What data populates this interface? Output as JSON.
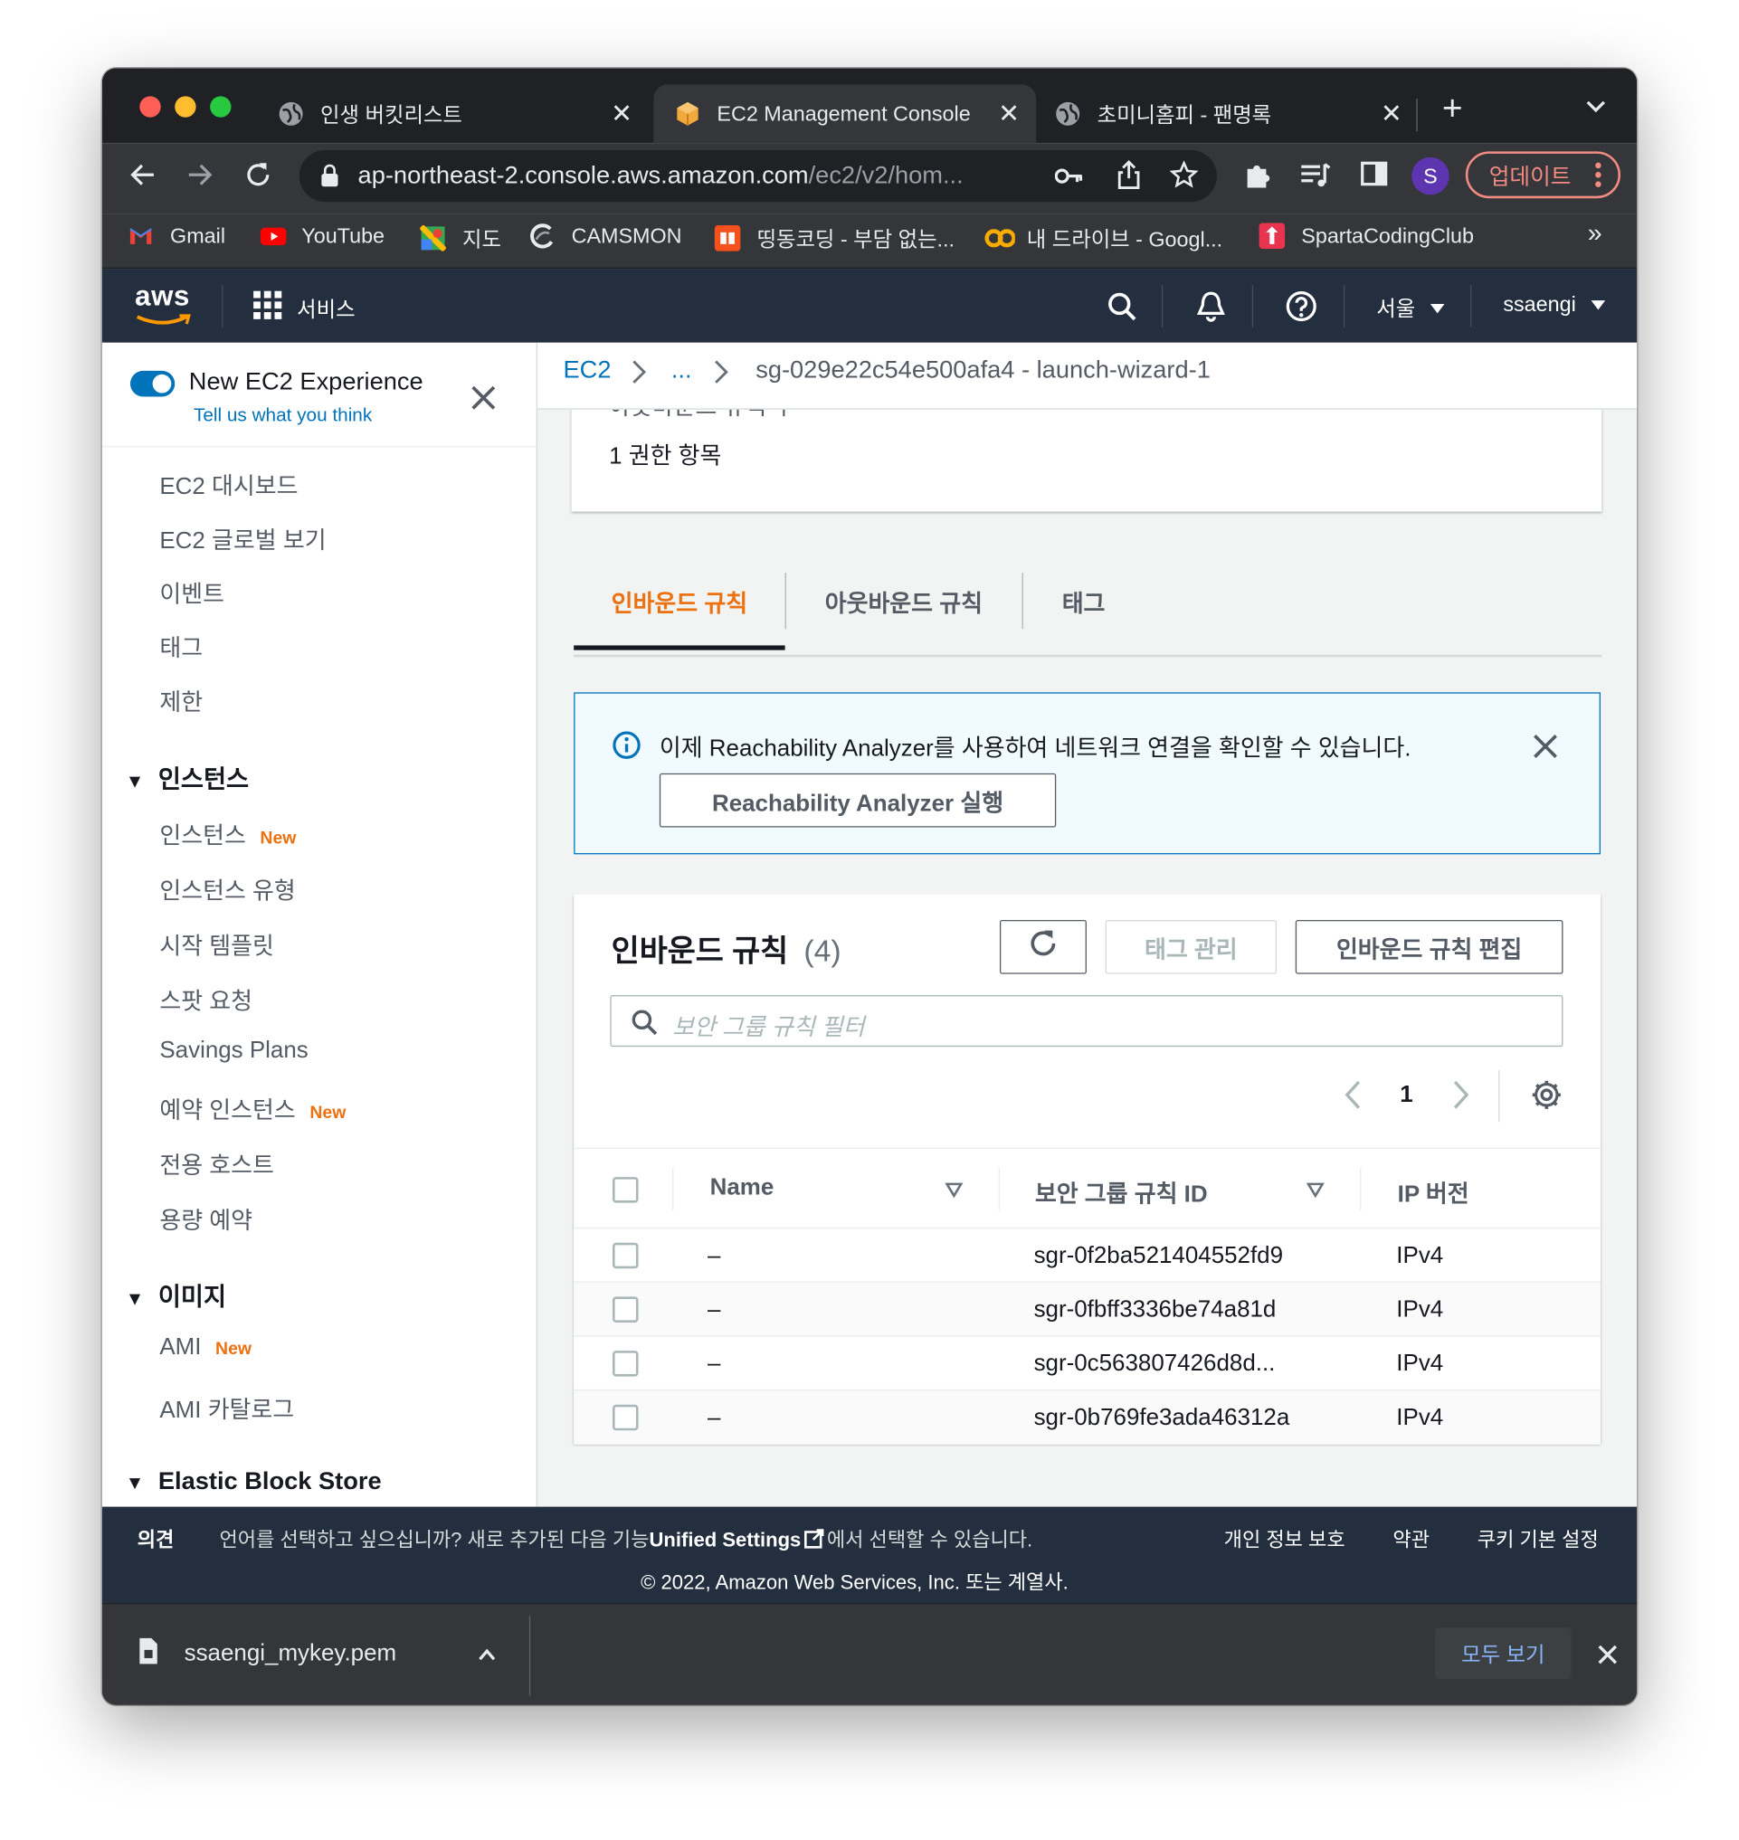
{
  "browser": {
    "tabs": [
      {
        "title": "인생 버킷리스트",
        "active": false
      },
      {
        "title": "EC2 Management Console",
        "active": true
      },
      {
        "title": "초미니홈피 - 팬명록",
        "active": false
      }
    ],
    "url_host": "ap-northeast-2.console.aws.amazon.com",
    "url_path": "/ec2/v2/hom...",
    "profile_initial": "S",
    "update_label": "업데이트",
    "bookmarks": [
      "Gmail",
      "YouTube",
      "지도",
      "CAMSMON",
      "띵동코딩 - 부담 없는...",
      "내 드라이브 - Googl...",
      "SpartaCodingClub"
    ],
    "bookmarks_more": "»"
  },
  "aws": {
    "logo": "aws",
    "services_label": "서비스",
    "region": "서울",
    "user": "ssaengi"
  },
  "sidebar": {
    "new_experience": "New EC2 Experience",
    "feedback_link": "Tell us what you think",
    "top_items": [
      "EC2 대시보드",
      "EC2 글로벌 보기",
      "이벤트",
      "태그",
      "제한"
    ],
    "sections": [
      {
        "title": "인스턴스",
        "items": [
          {
            "label": "인스턴스",
            "badge": "New"
          },
          {
            "label": "인스턴스 유형",
            "badge": ""
          },
          {
            "label": "시작 템플릿",
            "badge": ""
          },
          {
            "label": "스팟 요청",
            "badge": ""
          },
          {
            "label": "Savings Plans",
            "badge": ""
          },
          {
            "label": "예약 인스턴스",
            "badge": "New"
          },
          {
            "label": "전용 호스트",
            "badge": ""
          },
          {
            "label": "용량 예약",
            "badge": ""
          }
        ]
      },
      {
        "title": "이미지",
        "items": [
          {
            "label": "AMI",
            "badge": "New"
          },
          {
            "label": "AMI 카탈로그",
            "badge": ""
          }
        ]
      },
      {
        "title": "Elastic Block Store",
        "items": []
      }
    ]
  },
  "breadcrumb": {
    "root": "EC2",
    "ellipsis": "...",
    "current": "sg-029e22c54e500afa4 - launch-wizard-1"
  },
  "summary": {
    "partial_label": "아웃바운드 규칙 수",
    "value": "1 권한 항목"
  },
  "tabs": [
    "인바운드 규칙",
    "아웃바운드 규칙",
    "태그"
  ],
  "info": {
    "message": "이제 Reachability Analyzer를 사용하여 네트워크 연결을 확인할 수 있습니다.",
    "button": "Reachability Analyzer 실행"
  },
  "rules": {
    "title": "인바운드 규칙",
    "count": "(4)",
    "manage_tags": "태그 관리",
    "edit_button": "인바운드 규칙 편집",
    "filter_placeholder": "보안 그룹 규칙 필터",
    "page": "1",
    "columns": [
      "Name",
      "보안 그룹 규칙 ID",
      "IP 버전"
    ],
    "rows": [
      {
        "name": "–",
        "id": "sgr-0f2ba521404552fd9",
        "ip": "IPv4"
      },
      {
        "name": "–",
        "id": "sgr-0fbff3336be74a81d",
        "ip": "IPv4"
      },
      {
        "name": "–",
        "id": "sgr-0c563807426d8d...",
        "ip": "IPv4"
      },
      {
        "name": "–",
        "id": "sgr-0b769fe3ada46312a",
        "ip": "IPv4"
      }
    ]
  },
  "footer": {
    "feedback": "의견",
    "lang_msg_before": "언어를 선택하고 싶으십니까? 새로 추가된 다음 기능",
    "lang_msg_link": "Unified Settings",
    "lang_msg_after": "에서 선택할 수 있습니다.",
    "privacy": "개인 정보 보호",
    "terms": "약관",
    "cookies": "쿠키 기본 설정",
    "copyright": "© 2022, Amazon Web Services, Inc. 또는 계열사."
  },
  "download": {
    "filename": "ssaengi_mykey.pem",
    "show_all": "모두 보기"
  },
  "colors": {
    "aws_dark": "#232f3e",
    "aws_orange": "#ec7211",
    "link_blue": "#0073bb",
    "chrome_dark": "#202124"
  }
}
